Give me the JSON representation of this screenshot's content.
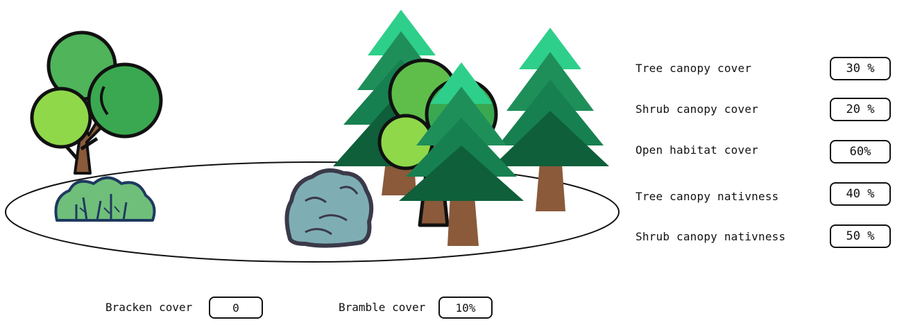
{
  "metrics": [
    {
      "label": "Tree canopy cover",
      "value": "30 %"
    },
    {
      "label": "Shrub canopy cover",
      "value": "20 %"
    },
    {
      "label": "Open habitat cover",
      "value": "60%"
    },
    {
      "label": "Tree canopy nativness",
      "value": "40 %"
    },
    {
      "label": "Shrub canopy nativness",
      "value": "50 %"
    }
  ],
  "ground_cover": {
    "bracken": {
      "label": "Bracken cover",
      "value": "0"
    },
    "bramble": {
      "label": "Bramble cover",
      "value": "10%"
    }
  },
  "colors": {
    "deciduous_light": "#8fd84a",
    "deciduous_mid": "#5fbd4a",
    "deciduous_dark": "#2f9b49",
    "conifer_top": "#2ecf8a",
    "conifer_mid": "#1f8f5a",
    "conifer_dark": "#0e5f3a",
    "trunk": "#8a5a3a",
    "shrub_fill": "#6fbf7a",
    "shrub_outline": "#1e3a5f",
    "bramble_fill": "#7eaeb4",
    "bramble_outline": "#3a3a4a"
  },
  "icons": [
    "deciduous-tree-icon",
    "shrub-icon",
    "bramble-icon",
    "conifer-tree-icon"
  ]
}
